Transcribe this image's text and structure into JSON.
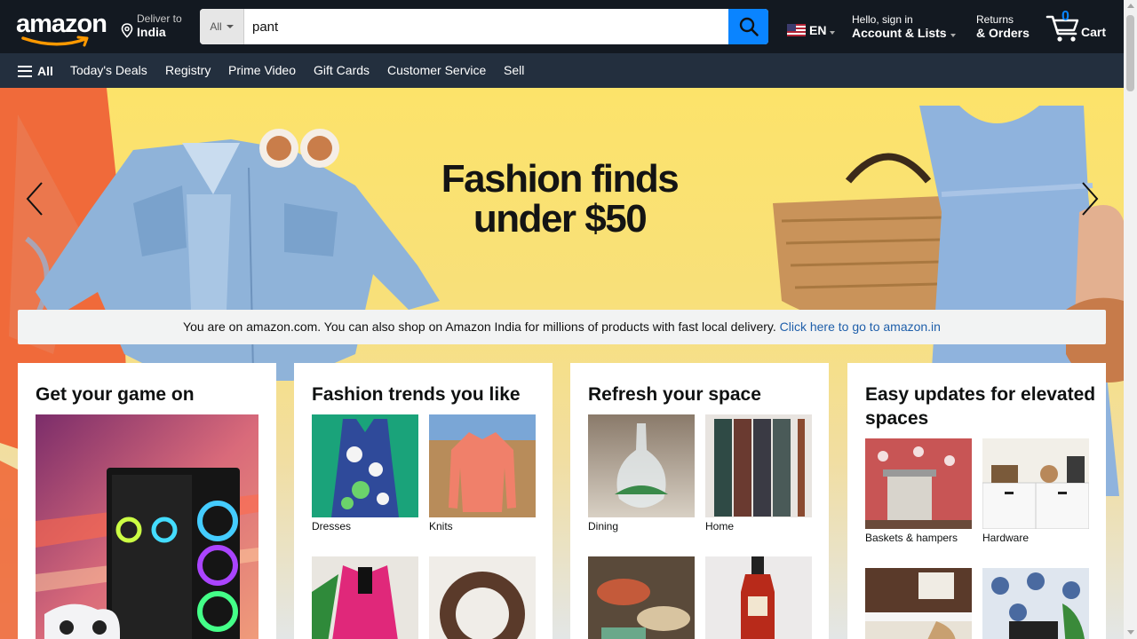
{
  "header": {
    "logo_text": "amazon",
    "deliver_line1": "Deliver to",
    "deliver_line2": "India",
    "search_category": "All",
    "search_query": "pant",
    "language": "EN",
    "account_line1": "Hello, sign in",
    "account_line2": "Account & Lists",
    "returns_line1": "Returns",
    "returns_line2": "& Orders",
    "cart_count": "0",
    "cart_label": "Cart",
    "accent_color": "#0a84ff"
  },
  "subnav": {
    "all_label": "All",
    "links": [
      "Today's Deals",
      "Registry",
      "Prime Video",
      "Gift Cards",
      "Customer Service",
      "Sell"
    ]
  },
  "hero": {
    "title_line1": "Fashion finds",
    "title_line2": "under $50"
  },
  "notice": {
    "text": "You are on amazon.com. You can also shop on Amazon India for millions of products with fast local delivery.",
    "link_text": "Click here to go to amazon.in"
  },
  "cards": [
    {
      "title": "Get your game on",
      "tiles": []
    },
    {
      "title": "Fashion trends you like",
      "tiles": [
        "Dresses",
        "Knits"
      ]
    },
    {
      "title": "Refresh your space",
      "tiles": [
        "Dining",
        "Home"
      ]
    },
    {
      "title": "Easy updates for elevated spaces",
      "tiles": [
        "Baskets & hampers",
        "Hardware"
      ]
    }
  ]
}
